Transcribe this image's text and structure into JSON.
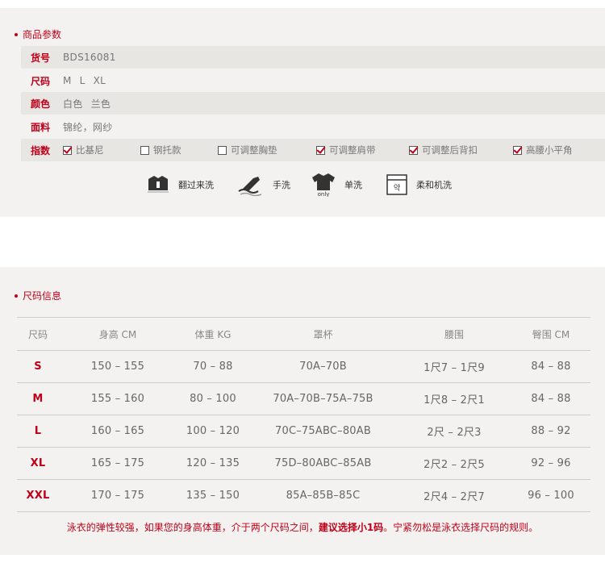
{
  "params": {
    "heading": "商品参数",
    "rows": [
      {
        "label": "货号",
        "values": [
          "BDS16081"
        ]
      },
      {
        "label": "尺码",
        "values": [
          "M",
          "L",
          "XL"
        ]
      },
      {
        "label": "颜色",
        "values": [
          "白色",
          "兰色"
        ]
      },
      {
        "label": "面料",
        "values": [
          "锦纶，网纱"
        ]
      }
    ],
    "features_label": "指数",
    "features": [
      {
        "label": "比基尼",
        "checked": true
      },
      {
        "label": "钢托款",
        "checked": false
      },
      {
        "label": "可调整胸垫",
        "checked": false
      },
      {
        "label": "可调整肩带",
        "checked": true
      },
      {
        "label": "可调整后背扣",
        "checked": true
      },
      {
        "label": "高腰小平角",
        "checked": true
      }
    ],
    "care": [
      {
        "label": "翻过来洗",
        "icon": "inside-out-wash-icon"
      },
      {
        "label": "手洗",
        "icon": "hand-wash-icon"
      },
      {
        "label": "单洗",
        "icon": "wash-separately-icon",
        "icon_text": "only"
      },
      {
        "label": "柔和机洗",
        "icon": "gentle-machine-wash-icon",
        "icon_text": "약"
      }
    ]
  },
  "size_info": {
    "heading": "尺码信息",
    "columns": [
      "尺码",
      "身高 CM",
      "体重 KG",
      "罩杯",
      "腰围",
      "臀围 CM"
    ],
    "rows": [
      [
        "S",
        "150 – 155",
        "70 – 88",
        "70A–70B",
        "1尺7 – 1尺9",
        "84 – 88"
      ],
      [
        "M",
        "155 – 160",
        "80 – 100",
        "70A–70B–75A–75B",
        "1尺8 – 2尺1",
        "84 – 88"
      ],
      [
        "L",
        "160 – 165",
        "100 – 120",
        "70C–75ABC–80AB",
        "2尺 – 2尺3",
        "88 – 92"
      ],
      [
        "XL",
        "165 – 175",
        "120 – 135",
        "75D–80ABC–85AB",
        "2尺2 – 2尺5",
        "92 – 96"
      ],
      [
        "XXL",
        "170 – 175",
        "135 – 150",
        "85A–85B–85C",
        "2尺4 – 2尺7",
        "96 – 100"
      ]
    ],
    "note_before": "泳衣的弹性较强，如果您的身高体重，介于两个尺码之间，",
    "note_bold": "建议选择小1码",
    "note_after": "。宁紧勿松是泳衣选择尺码的规则。"
  },
  "colors": {
    "accent": "#c0001a",
    "panel": "#f3f2f0",
    "row_shade": "#e8e6e3"
  }
}
